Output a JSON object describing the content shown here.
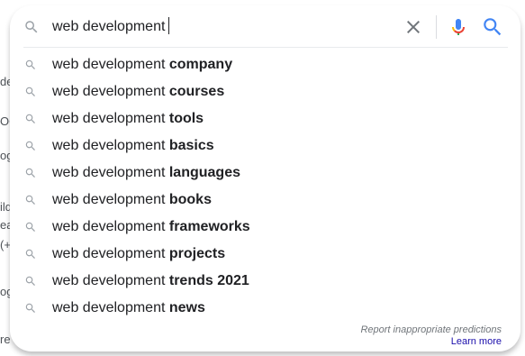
{
  "search": {
    "query": "web development",
    "clear_icon": "close-icon",
    "mic_icon": "microphone-icon",
    "search_icon": "search-icon"
  },
  "suggestions": [
    {
      "prefix": "web development ",
      "completion": "company"
    },
    {
      "prefix": "web development ",
      "completion": "courses"
    },
    {
      "prefix": "web development ",
      "completion": "tools"
    },
    {
      "prefix": "web development ",
      "completion": "basics"
    },
    {
      "prefix": "web development ",
      "completion": "languages"
    },
    {
      "prefix": "web development ",
      "completion": "books"
    },
    {
      "prefix": "web development ",
      "completion": "frameworks"
    },
    {
      "prefix": "web development ",
      "completion": "projects"
    },
    {
      "prefix": "web development ",
      "completion": "trends 2021"
    },
    {
      "prefix": "web development ",
      "completion": "news"
    }
  ],
  "footer": {
    "report": "Report inappropriate predictions",
    "learn_more": "Learn more"
  },
  "background_fragments": [
    "de",
    "OC",
    "og",
    "ild",
    "ea",
    "(+",
    "og",
    "re"
  ],
  "colors": {
    "link": "#1a0dab",
    "icon_gray": "#9aa0a6",
    "search_blue": "#4285f4",
    "mic_red": "#ea4335",
    "mic_yellow": "#fbbc04",
    "mic_green": "#34a853"
  }
}
